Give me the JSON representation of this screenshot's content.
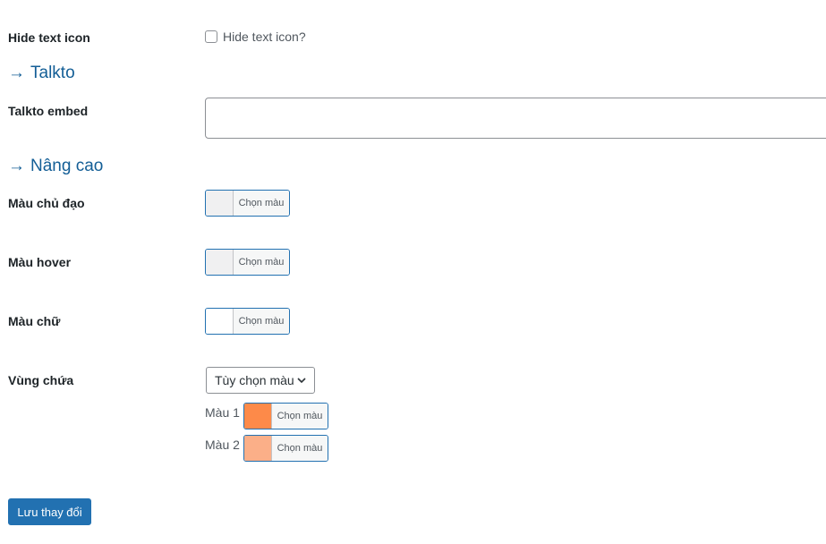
{
  "hide_text_icon": {
    "label": "Hide text icon",
    "checkbox_label": "Hide text icon?"
  },
  "talkto_section": {
    "title": "Talkto",
    "embed_label": "Talkto embed",
    "embed_value": ""
  },
  "advanced_section": {
    "title": "Nâng cao",
    "fields": [
      {
        "label": "Màu chủ đạo",
        "button": "Chọn màu",
        "color": "#f0f0f1"
      },
      {
        "label": "Màu hover",
        "button": "Chọn màu",
        "color": "#f0f0f1"
      },
      {
        "label": "Màu chữ",
        "button": "Chọn màu",
        "color": "#ffffff"
      }
    ],
    "container": {
      "label": "Vùng chứa",
      "select_value": "Tùy chọn màu",
      "colors": [
        {
          "label": "Màu 1",
          "button": "Chọn màu",
          "color": "#fd8a49"
        },
        {
          "label": "Màu 2",
          "button": "Chọn màu",
          "color": "#fbaf88"
        }
      ]
    }
  },
  "save_button": "Lưu thay đổi"
}
